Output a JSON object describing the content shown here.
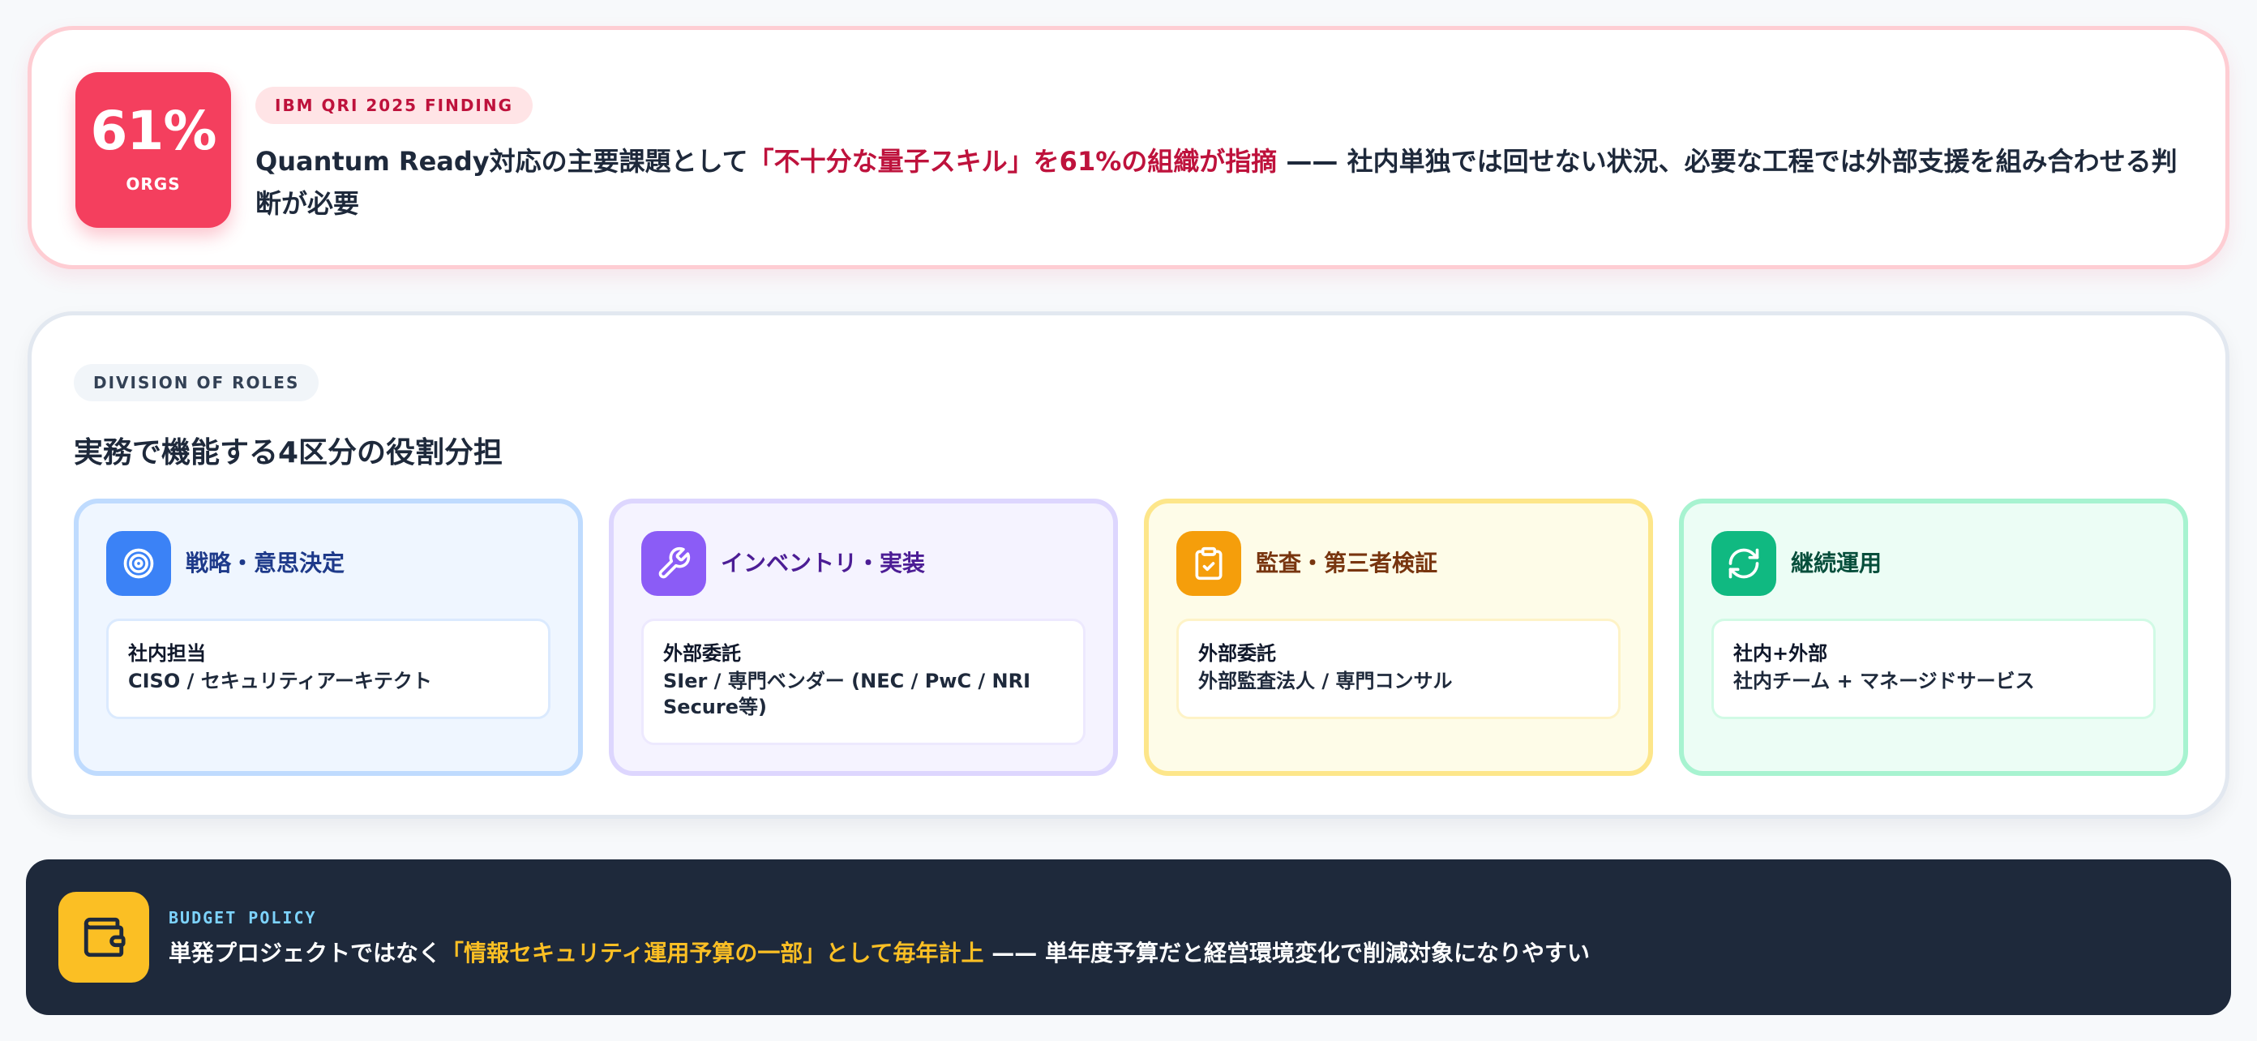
{
  "finding": {
    "stat_value": "61%",
    "stat_unit": "ORGS",
    "tag": "IBM QRI 2025 FINDING",
    "text_before": "Quantum Ready対応の主要課題として",
    "text_highlight": "「不十分な量子スキル」を61%の組織が指摘",
    "text_after": " —— 社内単独では回せない状況、必要な工程では外部支援を組み合わせる判断が必要",
    "colors": {
      "accent": "#f43f5e",
      "highlight": "#be123c"
    }
  },
  "roles": {
    "tag": "DIVISION OF ROLES",
    "title": "実務で機能する4区分の役割分担",
    "items": [
      {
        "title": "戦略・意思決定",
        "icon": "target-icon",
        "owner": "社内担当",
        "detail": "CISO / セキュリティアーキテクト",
        "color": "#3b82f6"
      },
      {
        "title": "インベントリ・実装",
        "icon": "wrench-icon",
        "owner": "外部委託",
        "detail": "SIer / 専門ベンダー (NEC / PwC / NRI Secure等)",
        "color": "#8b5cf6"
      },
      {
        "title": "監査・第三者検証",
        "icon": "clipboard-check-icon",
        "owner": "外部委託",
        "detail": "外部監査法人 / 専門コンサル",
        "color": "#f59e0b"
      },
      {
        "title": "継続運用",
        "icon": "refresh-icon",
        "owner": "社内+外部",
        "detail": "社内チーム + マネージドサービス",
        "color": "#10b981"
      }
    ]
  },
  "budget": {
    "tag": "BUDGET POLICY",
    "icon": "wallet-icon",
    "text_before": "単発プロジェクトではなく",
    "text_highlight": "「情報セキュリティ運用予算の一部」として毎年計上",
    "text_after": " —— 単年度予算だと経営環境変化で削減対象になりやすい",
    "colors": {
      "background": "#1e293b",
      "highlight": "#fbbf24"
    }
  }
}
